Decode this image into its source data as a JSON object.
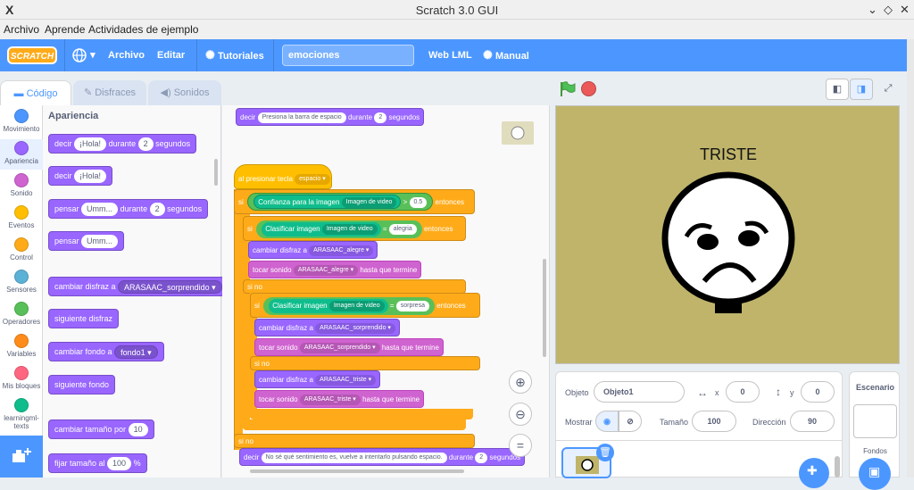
{
  "window": {
    "title": "Scratch 3.0 GUI"
  },
  "app_menu": [
    "Archivo",
    "Aprende",
    "Actividades de ejemplo"
  ],
  "scratch_menu": {
    "logo": "SCRATCH",
    "archivo": "Archivo",
    "editar": "Editar",
    "tutoriales": "Tutoriales",
    "project_title": "emociones",
    "web_lml": "Web LML",
    "manual": "Manual"
  },
  "tabs": {
    "code": "Código",
    "costumes": "Disfraces",
    "sounds": "Sonidos"
  },
  "categories": [
    {
      "label": "Movimiento",
      "color": "#4c97ff"
    },
    {
      "label": "Apariencia",
      "color": "#9966ff"
    },
    {
      "label": "Sonido",
      "color": "#cf63cf"
    },
    {
      "label": "Eventos",
      "color": "#ffbf00"
    },
    {
      "label": "Control",
      "color": "#ffab19"
    },
    {
      "label": "Sensores",
      "color": "#5cb1d6"
    },
    {
      "label": "Operadores",
      "color": "#59c059"
    },
    {
      "label": "Variables",
      "color": "#ff8c1a"
    },
    {
      "label": "Mis bloques",
      "color": "#ff6680"
    },
    {
      "label": "learningml-texts",
      "color": "#0fbd8c"
    }
  ],
  "palette": {
    "title": "Apariencia",
    "say_for": {
      "a": "decir",
      "msg": "¡Hola!",
      "b": "durante",
      "n": "2",
      "c": "segundos"
    },
    "say": {
      "a": "decir",
      "msg": "¡Hola!"
    },
    "think_for": {
      "a": "pensar",
      "msg": "Umm...",
      "b": "durante",
      "n": "2",
      "c": "segundos"
    },
    "think": {
      "a": "pensar",
      "msg": "Umm..."
    },
    "switch_costume": {
      "a": "cambiar disfraz a",
      "v": "ARASAAC_sorprendido"
    },
    "next_costume": "siguiente disfraz",
    "switch_backdrop": {
      "a": "cambiar fondo a",
      "v": "fondo1"
    },
    "next_backdrop": "siguiente fondo",
    "change_size": {
      "a": "cambiar tamaño por",
      "v": "10"
    },
    "set_size": {
      "a": "fijar tamaño al",
      "v": "100",
      "b": "%"
    }
  },
  "script": {
    "say_top": {
      "a": "decir",
      "msg": "Presiona la barra de espacio",
      "b": "durante",
      "n": "2",
      "c": "segundos"
    },
    "hat": {
      "a": "al presionar tecla",
      "key": "espacio"
    },
    "if1": {
      "a": "si",
      "b": "Confianza para la imagen",
      "c": "Imagen de video",
      "op": ">",
      "v": "0.5",
      "d": "entonces"
    },
    "if2": {
      "a": "si",
      "b": "Clasificar imagen",
      "c": "Imagen de video",
      "op": "=",
      "v": "alegria",
      "d": "entonces"
    },
    "costume_happy": {
      "a": "cambiar disfraz a",
      "v": "ARASAAC_alegre"
    },
    "sound_happy": {
      "a": "tocar sonido",
      "v": "ARASAAC_alegre",
      "b": "hasta que termine"
    },
    "else1": "si no",
    "if3": {
      "a": "si",
      "b": "Clasificar imagen",
      "c": "Imagen de video",
      "op": "=",
      "v": "sorpresa",
      "d": "entonces"
    },
    "costume_surprise": {
      "a": "cambiar disfraz a",
      "v": "ARASAAC_sorprendido"
    },
    "sound_surprise": {
      "a": "tocar sonido",
      "v": "ARASAAC_sorprendido",
      "b": "hasta que termine"
    },
    "else2": "si no",
    "costume_sad": {
      "a": "cambiar disfraz a",
      "v": "ARASAAC_triste"
    },
    "sound_sad": {
      "a": "tocar sonido",
      "v": "ARASAAC_triste",
      "b": "hasta que termine"
    },
    "else3": "si no",
    "say_bottom": {
      "a": "decir",
      "msg": "No sé qué sentimiento es, vuelve a intentarlo pulsando espacio.",
      "b": "durante",
      "n": "2",
      "c": "segundos"
    }
  },
  "stage": {
    "caption": "TRISTE"
  },
  "sprite_info": {
    "sprite_label": "Objeto",
    "sprite_name": "Objeto1",
    "x_label": "x",
    "x": "0",
    "y_label": "y",
    "y": "0",
    "show_label": "Mostrar",
    "size_label": "Tamaño",
    "size": "100",
    "direction_label": "Dirección",
    "direction": "90"
  },
  "stage_panel": {
    "title": "Escenario",
    "backdrops_label": "Fondos"
  }
}
